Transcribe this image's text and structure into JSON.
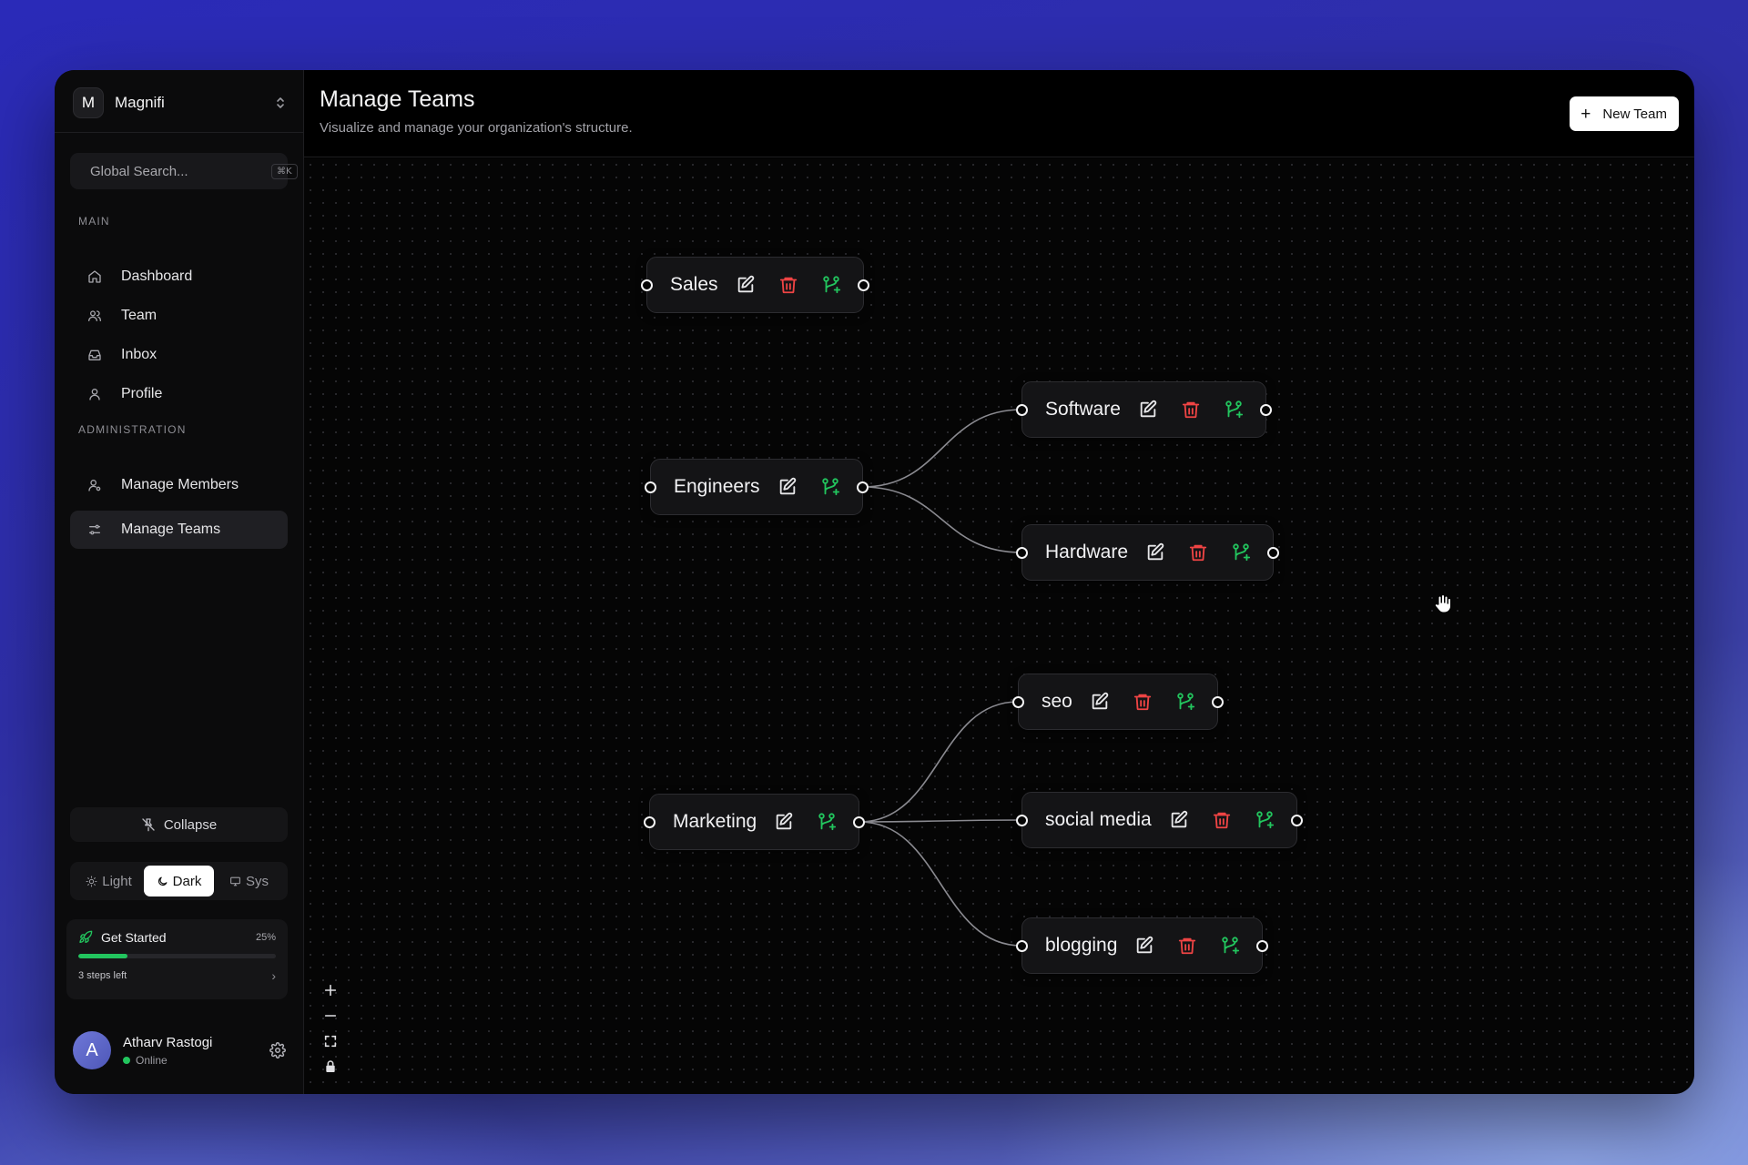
{
  "org": {
    "avatar_letter": "M",
    "name": "Magnifi"
  },
  "search": {
    "placeholder": "Global Search...",
    "shortcut": "⌘K"
  },
  "sections": {
    "main": "MAIN",
    "admin": "ADMINISTRATION"
  },
  "nav_main": [
    {
      "label": "Dashboard",
      "icon": "home-icon"
    },
    {
      "label": "Team",
      "icon": "users-icon"
    },
    {
      "label": "Inbox",
      "icon": "inbox-icon"
    },
    {
      "label": "Profile",
      "icon": "user-icon"
    }
  ],
  "nav_admin": [
    {
      "label": "Manage Members",
      "icon": "user-cog-icon"
    },
    {
      "label": "Manage Teams",
      "icon": "sliders-icon",
      "active": true
    }
  ],
  "collapse_label": "Collapse",
  "theme": {
    "light": "Light",
    "dark": "Dark",
    "sys": "Sys",
    "selected": "Dark"
  },
  "get_started": {
    "title": "Get Started",
    "percent_label": "25%",
    "progress": 0.25,
    "steps": "3 steps left"
  },
  "user": {
    "initial": "A",
    "name": "Atharv Rastogi",
    "status": "Online"
  },
  "header": {
    "title": "Manage Teams",
    "subtitle": "Visualize and manage your organization's structure.",
    "new_team_label": "New Team"
  },
  "teams": [
    {
      "id": "sales",
      "label": "Sales",
      "deletable": true
    },
    {
      "id": "engineers",
      "label": "Engineers",
      "deletable": false
    },
    {
      "id": "software",
      "label": "Software",
      "deletable": true,
      "parent": "engineers"
    },
    {
      "id": "hardware",
      "label": "Hardware",
      "deletable": true,
      "parent": "engineers"
    },
    {
      "id": "marketing",
      "label": "Marketing",
      "deletable": false
    },
    {
      "id": "seo",
      "label": "seo",
      "deletable": true,
      "parent": "marketing"
    },
    {
      "id": "social",
      "label": "social media",
      "deletable": true,
      "parent": "marketing"
    },
    {
      "id": "blogging",
      "label": "blogging",
      "deletable": true,
      "parent": "marketing"
    }
  ],
  "colors": {
    "accent_green": "#22c55e",
    "danger_red": "#ef4444",
    "canvas_bg": "#050505"
  }
}
